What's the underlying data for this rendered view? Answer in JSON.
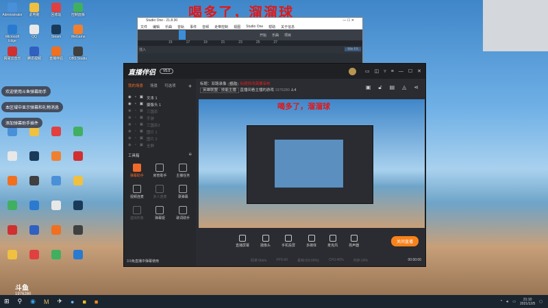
{
  "overlay_title": "喝多了，溜溜球",
  "watermark": {
    "brand": "斗鱼",
    "room_id": "1976280"
  },
  "desktop_icons": [
    {
      "label": "Administrator"
    },
    {
      "label": "此电脑"
    },
    {
      "label": "回收站"
    },
    {
      "label": "控制面板"
    },
    {
      "label": "Microsoft Edge"
    },
    {
      "label": "QQ"
    },
    {
      "label": "Steam"
    },
    {
      "label": "WeGame"
    },
    {
      "label": "网易云音乐"
    },
    {
      "label": "腾讯视频"
    },
    {
      "label": "直播伴侣"
    },
    {
      "label": "OBS Studio"
    }
  ],
  "notifications": [
    "欢迎使用斗鱼弹幕助手",
    "本区域中显示弹幕和礼物消息",
    "添加弹幕助手插件"
  ],
  "studio_one": {
    "title": "Studio One - 21.8.30",
    "menu": [
      "文件",
      "编辑",
      "乐曲",
      "音轨",
      "事件",
      "音频",
      "走带控制",
      "视图",
      "Studio One",
      "帮助",
      "关于信息"
    ],
    "tools": [
      "开始",
      "乐曲",
      "项目"
    ],
    "ruler": [
      "15",
      "17",
      "19",
      "21",
      "23",
      "25",
      "27"
    ],
    "track_insert": "插入",
    "mix_fx": "Mix FX"
  },
  "app": {
    "name": "直播伴侣",
    "version": "V5.0",
    "tabs": [
      "我的场景",
      "场景",
      "可选项"
    ],
    "sources": [
      {
        "label": "文本 1",
        "active": true
      },
      {
        "label": "摄像头 1",
        "active": true
      },
      {
        "label": "三国杀",
        "active": false
      },
      {
        "label": "手游",
        "active": false
      },
      {
        "label": "三国杀2",
        "active": false
      },
      {
        "label": "图片 1",
        "active": false
      },
      {
        "label": "图片 2",
        "active": false
      },
      {
        "label": "全屏",
        "active": false
      }
    ],
    "toolbox_title": "工具箱",
    "tools": [
      {
        "label": "弹幕助手",
        "state": "hot"
      },
      {
        "label": "房管助手",
        "state": "normal"
      },
      {
        "label": "主播任务",
        "state": "normal"
      },
      {
        "label": "视频连麦",
        "state": "normal"
      },
      {
        "label": "多人连麦",
        "state": "dim"
      },
      {
        "label": "录弹幕",
        "state": "normal"
      },
      {
        "label": "虚拟形象",
        "state": "dim"
      },
      {
        "label": "弹幕姬",
        "state": "normal"
      },
      {
        "label": "歌词助手",
        "state": "normal"
      }
    ],
    "side_footer": "3.5免直播中弹幕使用",
    "title_label": "标题：",
    "title_value": "双路录像",
    "edit_button": "修改",
    "title_warning": "标题修改需要审核",
    "category": "英雄联盟 - 技能主播",
    "room_desc": "直播间看主播的游戏",
    "room_id": "1976280",
    "viewer_count": "4",
    "bottom_buttons": [
      "直播屏幕",
      "摄像头",
      "手机投屏",
      "多媒体",
      "麦克风",
      "扬声器"
    ],
    "stop_button": "关闭直播",
    "status": [
      "码率:0kb/s",
      "FPS:60",
      "丢帧:0(0.00%)",
      "CPU:40%",
      "内存:18%"
    ],
    "timer": "00:00:00"
  },
  "taskbar": {
    "time": "21:10",
    "date": "2021/12/5"
  }
}
